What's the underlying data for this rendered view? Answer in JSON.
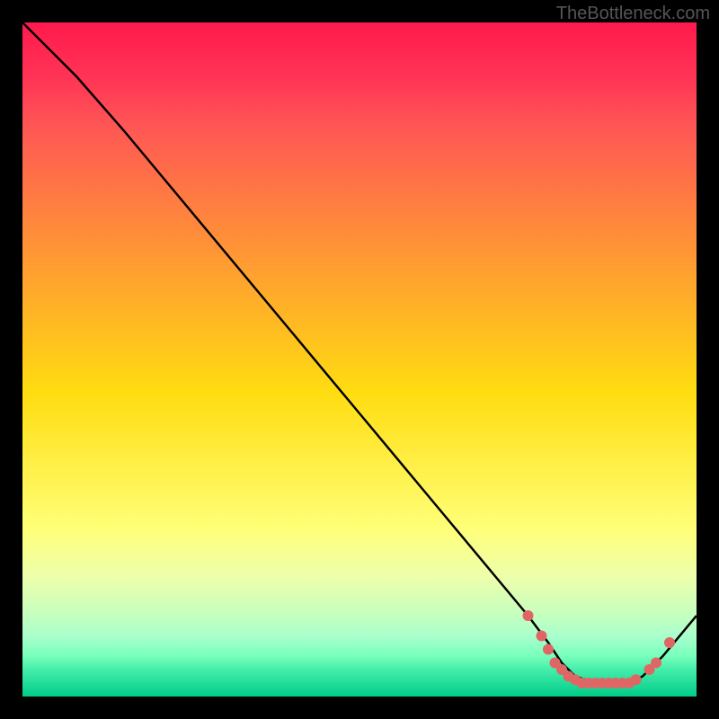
{
  "watermark": "TheBottleneck.com",
  "chart_data": {
    "type": "line",
    "title": "",
    "xlabel": "",
    "ylabel": "",
    "xlim": [
      0,
      100
    ],
    "ylim": [
      0,
      100
    ],
    "series": [
      {
        "name": "curve",
        "x": [
          0,
          8,
          15,
          20,
          30,
          40,
          50,
          60,
          70,
          75,
          78,
          80,
          82,
          85,
          88,
          90,
          92,
          95,
          100
        ],
        "y": [
          100,
          92,
          84,
          78,
          66,
          54,
          42,
          30,
          18,
          12,
          8,
          5,
          3,
          2,
          2,
          2,
          3,
          6,
          12
        ]
      }
    ],
    "markers": {
      "name": "dots",
      "color": "#e06666",
      "points": [
        {
          "x": 75,
          "y": 12
        },
        {
          "x": 77,
          "y": 9
        },
        {
          "x": 78,
          "y": 7
        },
        {
          "x": 79,
          "y": 5
        },
        {
          "x": 80,
          "y": 4
        },
        {
          "x": 81,
          "y": 3
        },
        {
          "x": 82,
          "y": 2.5
        },
        {
          "x": 83,
          "y": 2
        },
        {
          "x": 84,
          "y": 2
        },
        {
          "x": 85,
          "y": 2
        },
        {
          "x": 86,
          "y": 2
        },
        {
          "x": 87,
          "y": 2
        },
        {
          "x": 88,
          "y": 2
        },
        {
          "x": 89,
          "y": 2
        },
        {
          "x": 90,
          "y": 2
        },
        {
          "x": 91,
          "y": 2.5
        },
        {
          "x": 93,
          "y": 4
        },
        {
          "x": 94,
          "y": 5
        },
        {
          "x": 96,
          "y": 8
        }
      ]
    },
    "gradient_stops": [
      {
        "pos": 0,
        "color": "#ff1a4d"
      },
      {
        "pos": 50,
        "color": "#ffdd22"
      },
      {
        "pos": 100,
        "color": "#00cc88"
      }
    ]
  }
}
